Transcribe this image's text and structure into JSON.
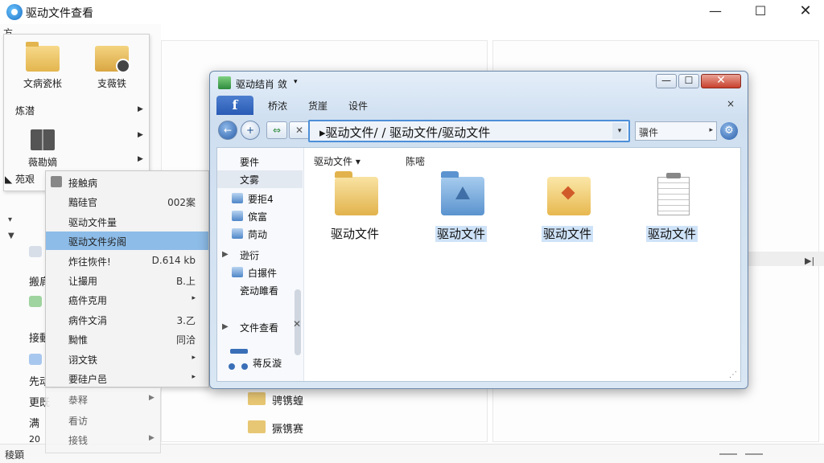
{
  "window": {
    "title": "驱动文件查看",
    "min_glyph": "—",
    "max_glyph": "☐",
    "close_glyph": "✕",
    "menu_stub": "方"
  },
  "ribbon": {
    "big_buttons": [
      {
        "label": "文病瓷枨",
        "icon": "folder-icon"
      },
      {
        "label": "支薇铁",
        "icon": "drive-icon"
      }
    ],
    "row1": "炼潜",
    "row2_label": "薇勘嫡",
    "row3": "苑艰"
  },
  "sidebar_bg": {
    "labels": [
      "搬肩",
      "接動",
      "先动",
      "更既",
      "满",
      "20"
    ]
  },
  "context_menu": {
    "items": [
      {
        "label": "接触病",
        "value": ""
      },
      {
        "label": "黯硅官",
        "value": "002案"
      },
      {
        "label": "驱动文件量",
        "value": ""
      },
      {
        "label": "驱动文件劣阁",
        "value": ""
      },
      {
        "label": "炸往恢件!",
        "value": "D.614 kb"
      },
      {
        "label": "让撮用",
        "value": "B.上"
      },
      {
        "label": "癌件克用",
        "value": "▸"
      },
      {
        "label": "病件文涓",
        "value": "3.乙"
      },
      {
        "label": "黝惟",
        "value": "同洽"
      },
      {
        "label": "诩文铁",
        "value": "▸"
      },
      {
        "label": "要硅户邑",
        "value": "▸"
      }
    ],
    "under_items": [
      "㳟释",
      "看访",
      "接钱"
    ],
    "highlighted_index": 3
  },
  "explorer": {
    "title": "驱动结肖 敛",
    "menus": [
      "桥浓",
      "货崖",
      "设件"
    ],
    "fb_tab": "f",
    "menubar_close": "×",
    "nav": {
      "back": "←",
      "forward": "+",
      "link": "⇔",
      "stop": "✕"
    },
    "address": "▸驱动文件/ / 驱动文件/驱动文件",
    "address_dropdown": "▾",
    "search": "骥件",
    "search_arrow": "▸",
    "settings": "⚙",
    "sidebar": [
      {
        "label": "要件",
        "icon": false
      },
      {
        "label": "文雾",
        "icon": false,
        "hl": true
      },
      {
        "label": "要拒4",
        "icon": true
      },
      {
        "label": "傧富",
        "icon": true
      },
      {
        "label": "苘动",
        "icon": true
      },
      {
        "label": "逊衍",
        "icon": false,
        "tri": true
      },
      {
        "label": "白搌件",
        "icon": true
      },
      {
        "label": "瓷动雎看",
        "icon": false
      },
      {
        "label": "文件查看",
        "icon": false,
        "tri": true
      },
      {
        "label": "蒋反漩",
        "icon": false
      }
    ],
    "sb_close": "✕",
    "column_headers": [
      {
        "label": "驱动文件 ▾"
      },
      {
        "label": "陈嘧"
      }
    ],
    "tiles": [
      {
        "label": "驱动文件",
        "icon": "folder-icon",
        "selected": false
      },
      {
        "label": "驱动文件",
        "icon": "blue-folder-icon",
        "selected": true
      },
      {
        "label": "驱动文件",
        "icon": "drive-folder-icon",
        "selected": true
      },
      {
        "label": "驱动文件",
        "icon": "document-icon",
        "selected": true
      }
    ],
    "grip": "⋰"
  },
  "bg_folders": [
    "骋镌蝗",
    "獗镌赛"
  ],
  "status": {
    "text": "稜顕"
  }
}
